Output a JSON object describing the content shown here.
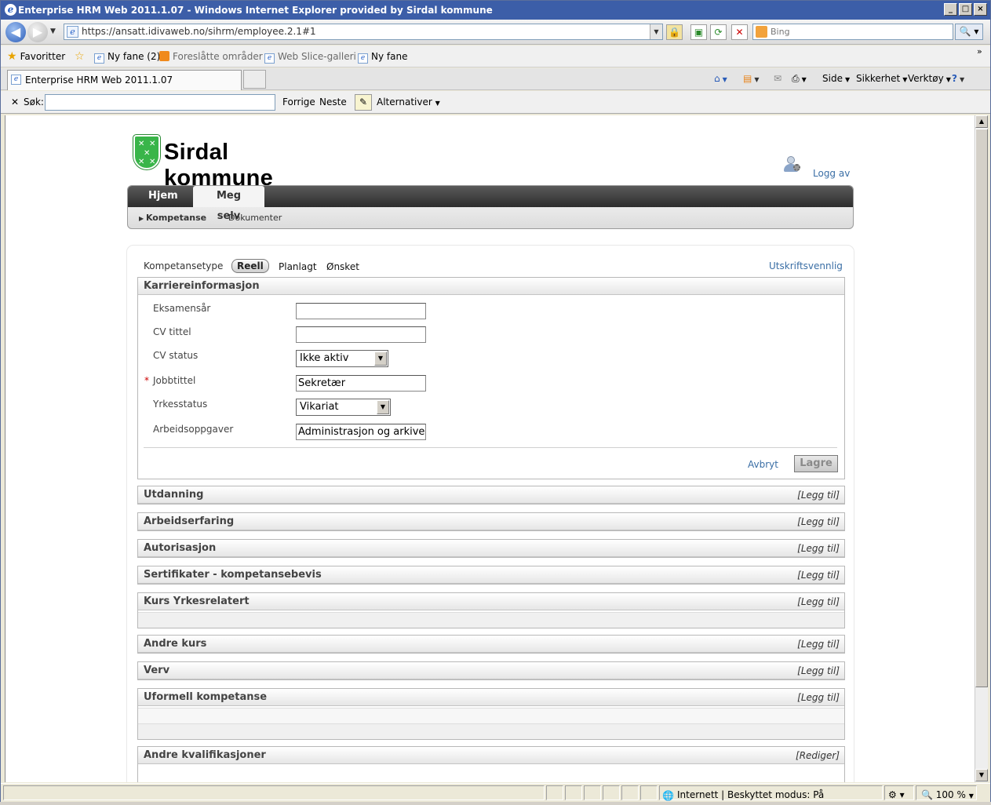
{
  "window": {
    "title": "Enterprise HRM Web 2011.1.07 - Windows Internet Explorer provided by Sirdal kommune",
    "minimize_glyph": "_",
    "maximize_glyph": "□",
    "close_glyph": "×"
  },
  "addressbar": {
    "url": "https://ansatt.idivaweb.no/sihrm/employee.2.1#1",
    "search_placeholder": "Bing"
  },
  "favorites": {
    "label": "Favoritter",
    "items": [
      "Ny fane (2)",
      "Foreslåtte områder",
      "Web Slice-galleri",
      "Ny fane"
    ]
  },
  "tabs": {
    "active": "Enterprise HRM Web 2011.1.07"
  },
  "commandbar": {
    "items": [
      "Side",
      "Sikkerhet",
      "Verktøy"
    ]
  },
  "findbar": {
    "label": "Søk:",
    "prev": "Forrige",
    "next": "Neste",
    "options": "Alternativer"
  },
  "page": {
    "logo_text": "Sirdal kommune",
    "logout": "Logg av",
    "nav": {
      "tabs": [
        "Hjem",
        "Meg selv"
      ],
      "active_tab": "Meg selv",
      "subnav": [
        "Kompetanse",
        "Dokumenter"
      ]
    },
    "type_filter": {
      "label": "Kompetansetype",
      "options": [
        "Reell",
        "Planlagt",
        "Ønsket"
      ],
      "selected": "Reell"
    },
    "print_link": "Utskriftsvennlig",
    "career": {
      "title": "Karriereinformasjon",
      "fields": {
        "exam_year": {
          "label": "Eksamensår",
          "value": ""
        },
        "cv_title": {
          "label": "CV tittel",
          "value": ""
        },
        "cv_status": {
          "label": "CV status",
          "value": "Ikke aktiv"
        },
        "job_title": {
          "label": "Jobbtittel",
          "value": "Sekretær",
          "required_mark": "*"
        },
        "work_status": {
          "label": "Yrkesstatus",
          "value": "Vikariat"
        },
        "duties": {
          "label": "Arbeidsoppgaver",
          "value": "Administrasjon og arkivering"
        }
      },
      "cancel": "Avbryt",
      "save": "Lagre"
    },
    "sections": [
      {
        "title": "Utdanning",
        "action": "[Legg til]"
      },
      {
        "title": "Arbeidserfaring",
        "action": "[Legg til]"
      },
      {
        "title": "Autorisasjon",
        "action": "[Legg til]"
      },
      {
        "title": "Sertifikater - kompetansebevis",
        "action": "[Legg til]"
      },
      {
        "title": "Kurs Yrkesrelatert",
        "action": "[Legg til]"
      },
      {
        "title": "Andre kurs",
        "action": "[Legg til]"
      },
      {
        "title": "Verv",
        "action": "[Legg til]"
      },
      {
        "title": "Uformell kompetanse",
        "action": "[Legg til]"
      },
      {
        "title": "Andre kvalifikasjoner",
        "action": "[Rediger]"
      }
    ]
  },
  "statusbar": {
    "zone": "Internett | Beskyttet modus: På",
    "zoom": "100 %"
  }
}
